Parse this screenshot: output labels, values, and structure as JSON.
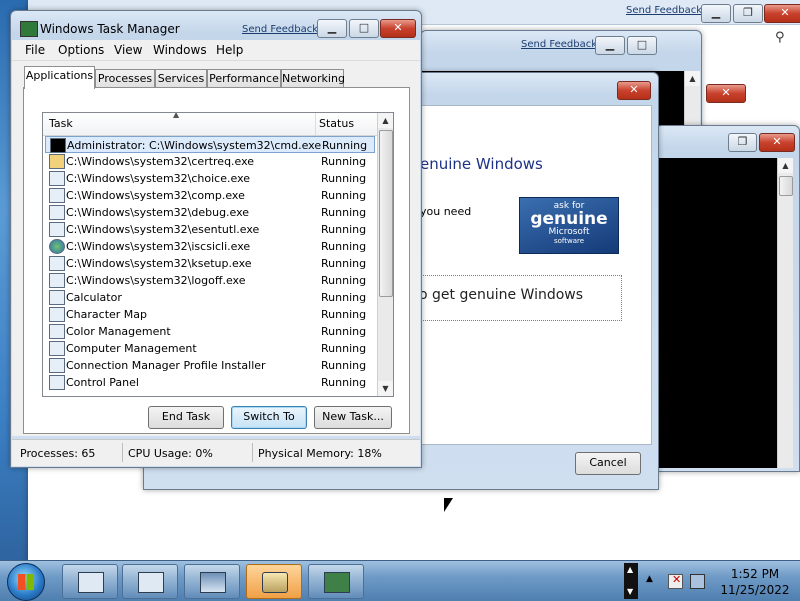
{
  "back_window": {
    "send_feedback": "Send Feedback"
  },
  "cmd_window_1": {
    "send_feedback": "Send Feedback"
  },
  "genuine_dialog": {
    "title_partial": "enuine Windows",
    "text_partial": "you need",
    "logo": {
      "line1": "ask for",
      "line2": "genuine",
      "line3": "Microsoft",
      "line4": "software"
    },
    "action_partial": "o get genuine Windows",
    "cancel_label": "Cancel"
  },
  "task_manager": {
    "title": "Windows Task Manager",
    "send_feedback": "Send Feedback",
    "menu": [
      "File",
      "Options",
      "View",
      "Windows",
      "Help"
    ],
    "tabs": [
      "Applications",
      "Processes",
      "Services",
      "Performance",
      "Networking"
    ],
    "active_tab": "Applications",
    "columns": {
      "task": "Task",
      "status": "Status"
    },
    "rows": [
      {
        "task": "Administrator: C:\\Windows\\system32\\cmd.exe",
        "status": "Running",
        "icon": "cmd-icon"
      },
      {
        "task": "C:\\Windows\\system32\\certreq.exe",
        "status": "Running",
        "icon": "certificate-icon"
      },
      {
        "task": "C:\\Windows\\system32\\choice.exe",
        "status": "Running",
        "icon": "window-icon"
      },
      {
        "task": "C:\\Windows\\system32\\comp.exe",
        "status": "Running",
        "icon": "window-icon"
      },
      {
        "task": "C:\\Windows\\system32\\debug.exe",
        "status": "Running",
        "icon": "window-icon"
      },
      {
        "task": "C:\\Windows\\system32\\esentutl.exe",
        "status": "Running",
        "icon": "window-icon"
      },
      {
        "task": "C:\\Windows\\system32\\iscsicli.exe",
        "status": "Running",
        "icon": "globe-icon"
      },
      {
        "task": "C:\\Windows\\system32\\ksetup.exe",
        "status": "Running",
        "icon": "window-icon"
      },
      {
        "task": "C:\\Windows\\system32\\logoff.exe",
        "status": "Running",
        "icon": "window-icon"
      },
      {
        "task": "Calculator",
        "status": "Running",
        "icon": "calculator-icon"
      },
      {
        "task": "Character Map",
        "status": "Running",
        "icon": "character-map-icon"
      },
      {
        "task": "Color Management",
        "status": "Running",
        "icon": "color-management-icon"
      },
      {
        "task": "Computer Management",
        "status": "Running",
        "icon": "computer-management-icon"
      },
      {
        "task": "Connection Manager Profile Installer",
        "status": "Running",
        "icon": "window-icon"
      },
      {
        "task": "Control Panel",
        "status": "Running",
        "icon": "control-panel-icon"
      }
    ],
    "buttons": {
      "end_task": "End Task",
      "switch_to": "Switch To",
      "new_task": "New Task..."
    },
    "status": {
      "processes": "Processes: 65",
      "cpu": "CPU Usage: 0%",
      "memory": "Physical Memory: 18%"
    }
  },
  "taskbar": {
    "buttons": [
      "window-icon",
      "window-icon",
      "network-icon",
      "drive-icon",
      "task-manager-icon"
    ],
    "active_index": 3,
    "clock_time": "1:52 PM",
    "clock_date": "11/25/2022"
  }
}
